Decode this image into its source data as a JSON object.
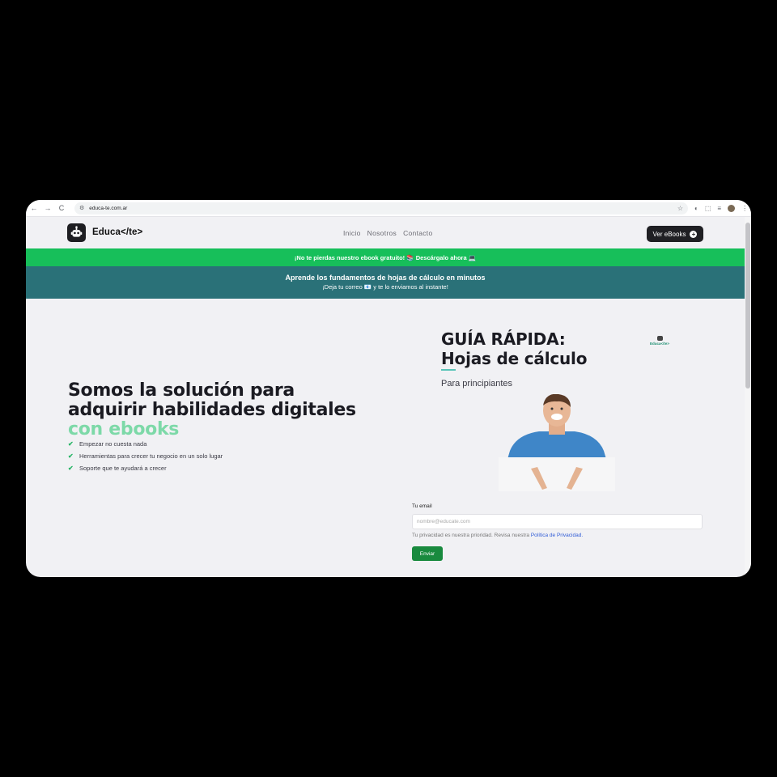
{
  "browser": {
    "url": "educa-te.com.ar",
    "back_icon": "←",
    "forward_icon": "→",
    "reload_icon": "C",
    "tune_icon": "⚙",
    "star_icon": "☆",
    "ext_icon": "◐",
    "puzzle_icon": "⬚",
    "reader_icon": "≡",
    "menu_icon": "⋮"
  },
  "header": {
    "logo_text": "Educa</te>",
    "nav": [
      "Inicio",
      "Nosotros",
      "Contacto"
    ],
    "cta_label": "Ver eBooks",
    "cta_icon": "+"
  },
  "promo": {
    "green_text": "¡No te pierdas nuestro ebook gratuito! 📚 Descárgalo ahora 💻",
    "teal_title": "Aprende los fundamentos de hojas de cálculo en minutos",
    "teal_sub": "¡Deja tu correo 📧 y te lo enviamos al instante!"
  },
  "hero": {
    "title_main": "Somos la solución para adquirir habilidades digitales ",
    "title_accent": "con ebooks",
    "features": [
      "Empezar no cuesta nada",
      "Herramientas para crecer tu negocio en un solo lugar",
      "Soporte que te ayudará a crecer"
    ],
    "check_icon": "✔"
  },
  "guide": {
    "title_line1": "GUÍA RÁPIDA:",
    "title_line2": "Hojas de cálculo",
    "subtitle": "Para principiantes",
    "mini_logo": "Educa</te>"
  },
  "form": {
    "email_label": "Tu email",
    "email_placeholder": "nombre@educate.com",
    "privacy_text": "Tu privacidad es nuestra prioridad. Revisa nuestra ",
    "privacy_link": "Política de Privacidad.",
    "submit_label": "Enviar"
  },
  "colors": {
    "promo_green": "#17bf5a",
    "promo_teal": "#2a7178",
    "accent": "#7dd9a8",
    "button_dark": "#1f1f23",
    "submit_green": "#198a3e"
  }
}
